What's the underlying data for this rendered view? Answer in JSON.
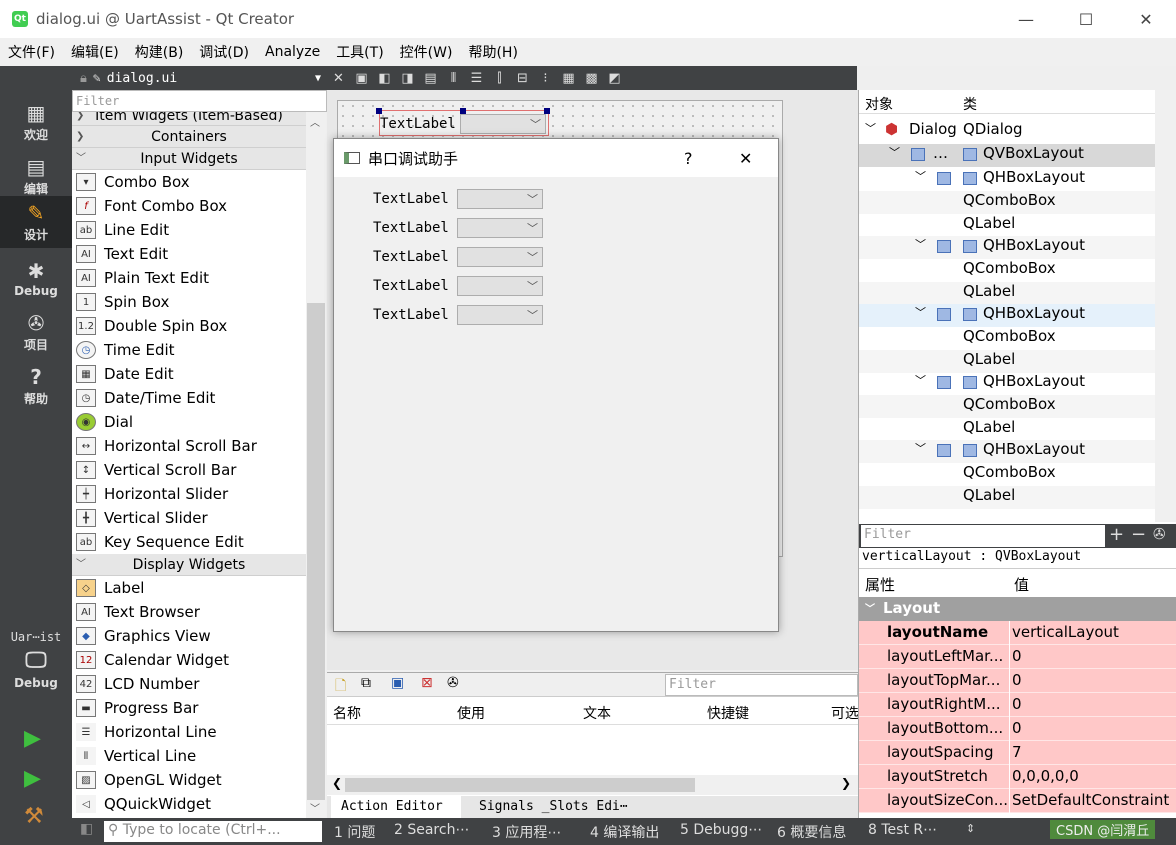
{
  "window": {
    "title": "dialog.ui @ UartAssist - Qt Creator",
    "minimize": "—",
    "maximize": "☐",
    "close": "✕"
  },
  "menu": [
    "文件(F)",
    "编辑(E)",
    "构建(B)",
    "调试(D)",
    "Analyze",
    "工具(T)",
    "控件(W)",
    "帮助(H)"
  ],
  "modes": [
    {
      "label": "欢迎",
      "icon": "grid-icon"
    },
    {
      "label": "编辑",
      "icon": "document-icon"
    },
    {
      "label": "设计",
      "icon": "pencil-icon"
    },
    {
      "label": "Debug",
      "icon": "bug-icon"
    },
    {
      "label": "项目",
      "icon": "wrench-icon"
    },
    {
      "label": "帮助",
      "icon": "help-icon"
    }
  ],
  "kit": {
    "project": "Uar⋯ist",
    "mode": "Debug"
  },
  "editor": {
    "file": "dialog.ui",
    "filter_placeholder": "Filter"
  },
  "widgetbox": {
    "top_partial": "Item Widgets (Item-Based)",
    "categories": [
      "Containers",
      "Input Widgets",
      "Display Widgets"
    ],
    "input_widgets": [
      "Combo Box",
      "Font Combo Box",
      "Line Edit",
      "Text Edit",
      "Plain Text Edit",
      "Spin Box",
      "Double Spin Box",
      "Time Edit",
      "Date Edit",
      "Date/Time Edit",
      "Dial",
      "Horizontal Scroll Bar",
      "Vertical Scroll Bar",
      "Horizontal Slider",
      "Vertical Slider",
      "Key Sequence Edit"
    ],
    "display_widgets": [
      "Label",
      "Text Browser",
      "Graphics View",
      "Calendar Widget",
      "LCD Number",
      "Progress Bar",
      "Horizontal Line",
      "Vertical Line",
      "OpenGL Widget",
      "QQuickWidget"
    ]
  },
  "form": {
    "selected_label": "TextLabel",
    "dialog_title": "串口调试助手",
    "help_btn": "?",
    "close_btn": "✕",
    "rows": [
      "TextLabel",
      "TextLabel",
      "TextLabel",
      "TextLabel",
      "TextLabel"
    ]
  },
  "action_editor": {
    "filter": "Filter",
    "columns": [
      "名称",
      "使用",
      "文本",
      "快捷键",
      "可选"
    ],
    "tabs": [
      "Action Editor",
      "Signals _Slots Edi⋯"
    ]
  },
  "object_inspector": {
    "headers": [
      "对象",
      "类"
    ],
    "root_name": "Dialog",
    "root_class": "QDialog",
    "layout_name": "…",
    "layout_class": "QVBoxLayout",
    "hbox": "QHBoxLayout",
    "combo": "QComboBox",
    "label": "QLabel"
  },
  "property_editor": {
    "filter": "Filter",
    "object": "verticalLayout : QVBoxLayout",
    "headers": [
      "属性",
      "值"
    ],
    "group": "Layout",
    "props": [
      {
        "name": "layoutName",
        "value": "verticalLayout"
      },
      {
        "name": "layoutLeftMar...",
        "value": "0"
      },
      {
        "name": "layoutTopMar...",
        "value": "0"
      },
      {
        "name": "layoutRightM...",
        "value": "0"
      },
      {
        "name": "layoutBottom...",
        "value": "0"
      },
      {
        "name": "layoutSpacing",
        "value": "7"
      },
      {
        "name": "layoutStretch",
        "value": "0,0,0,0,0"
      },
      {
        "name": "layoutSizeCon...",
        "value": "SetDefaultConstraint"
      }
    ]
  },
  "statusbar": {
    "locate": "Type to locate (Ctrl+...",
    "items": [
      "1 问题",
      "2 Search⋯",
      "3 应用程⋯",
      "4 编译输出",
      "5 Debugg⋯",
      "6 概要信息",
      "8 Test R⋯"
    ],
    "watermark": "CSDN @闫渭丘"
  },
  "colors": {
    "accent": "#404244",
    "property_highlight": "#ffc8c8",
    "qt_green": "#41cd52"
  }
}
